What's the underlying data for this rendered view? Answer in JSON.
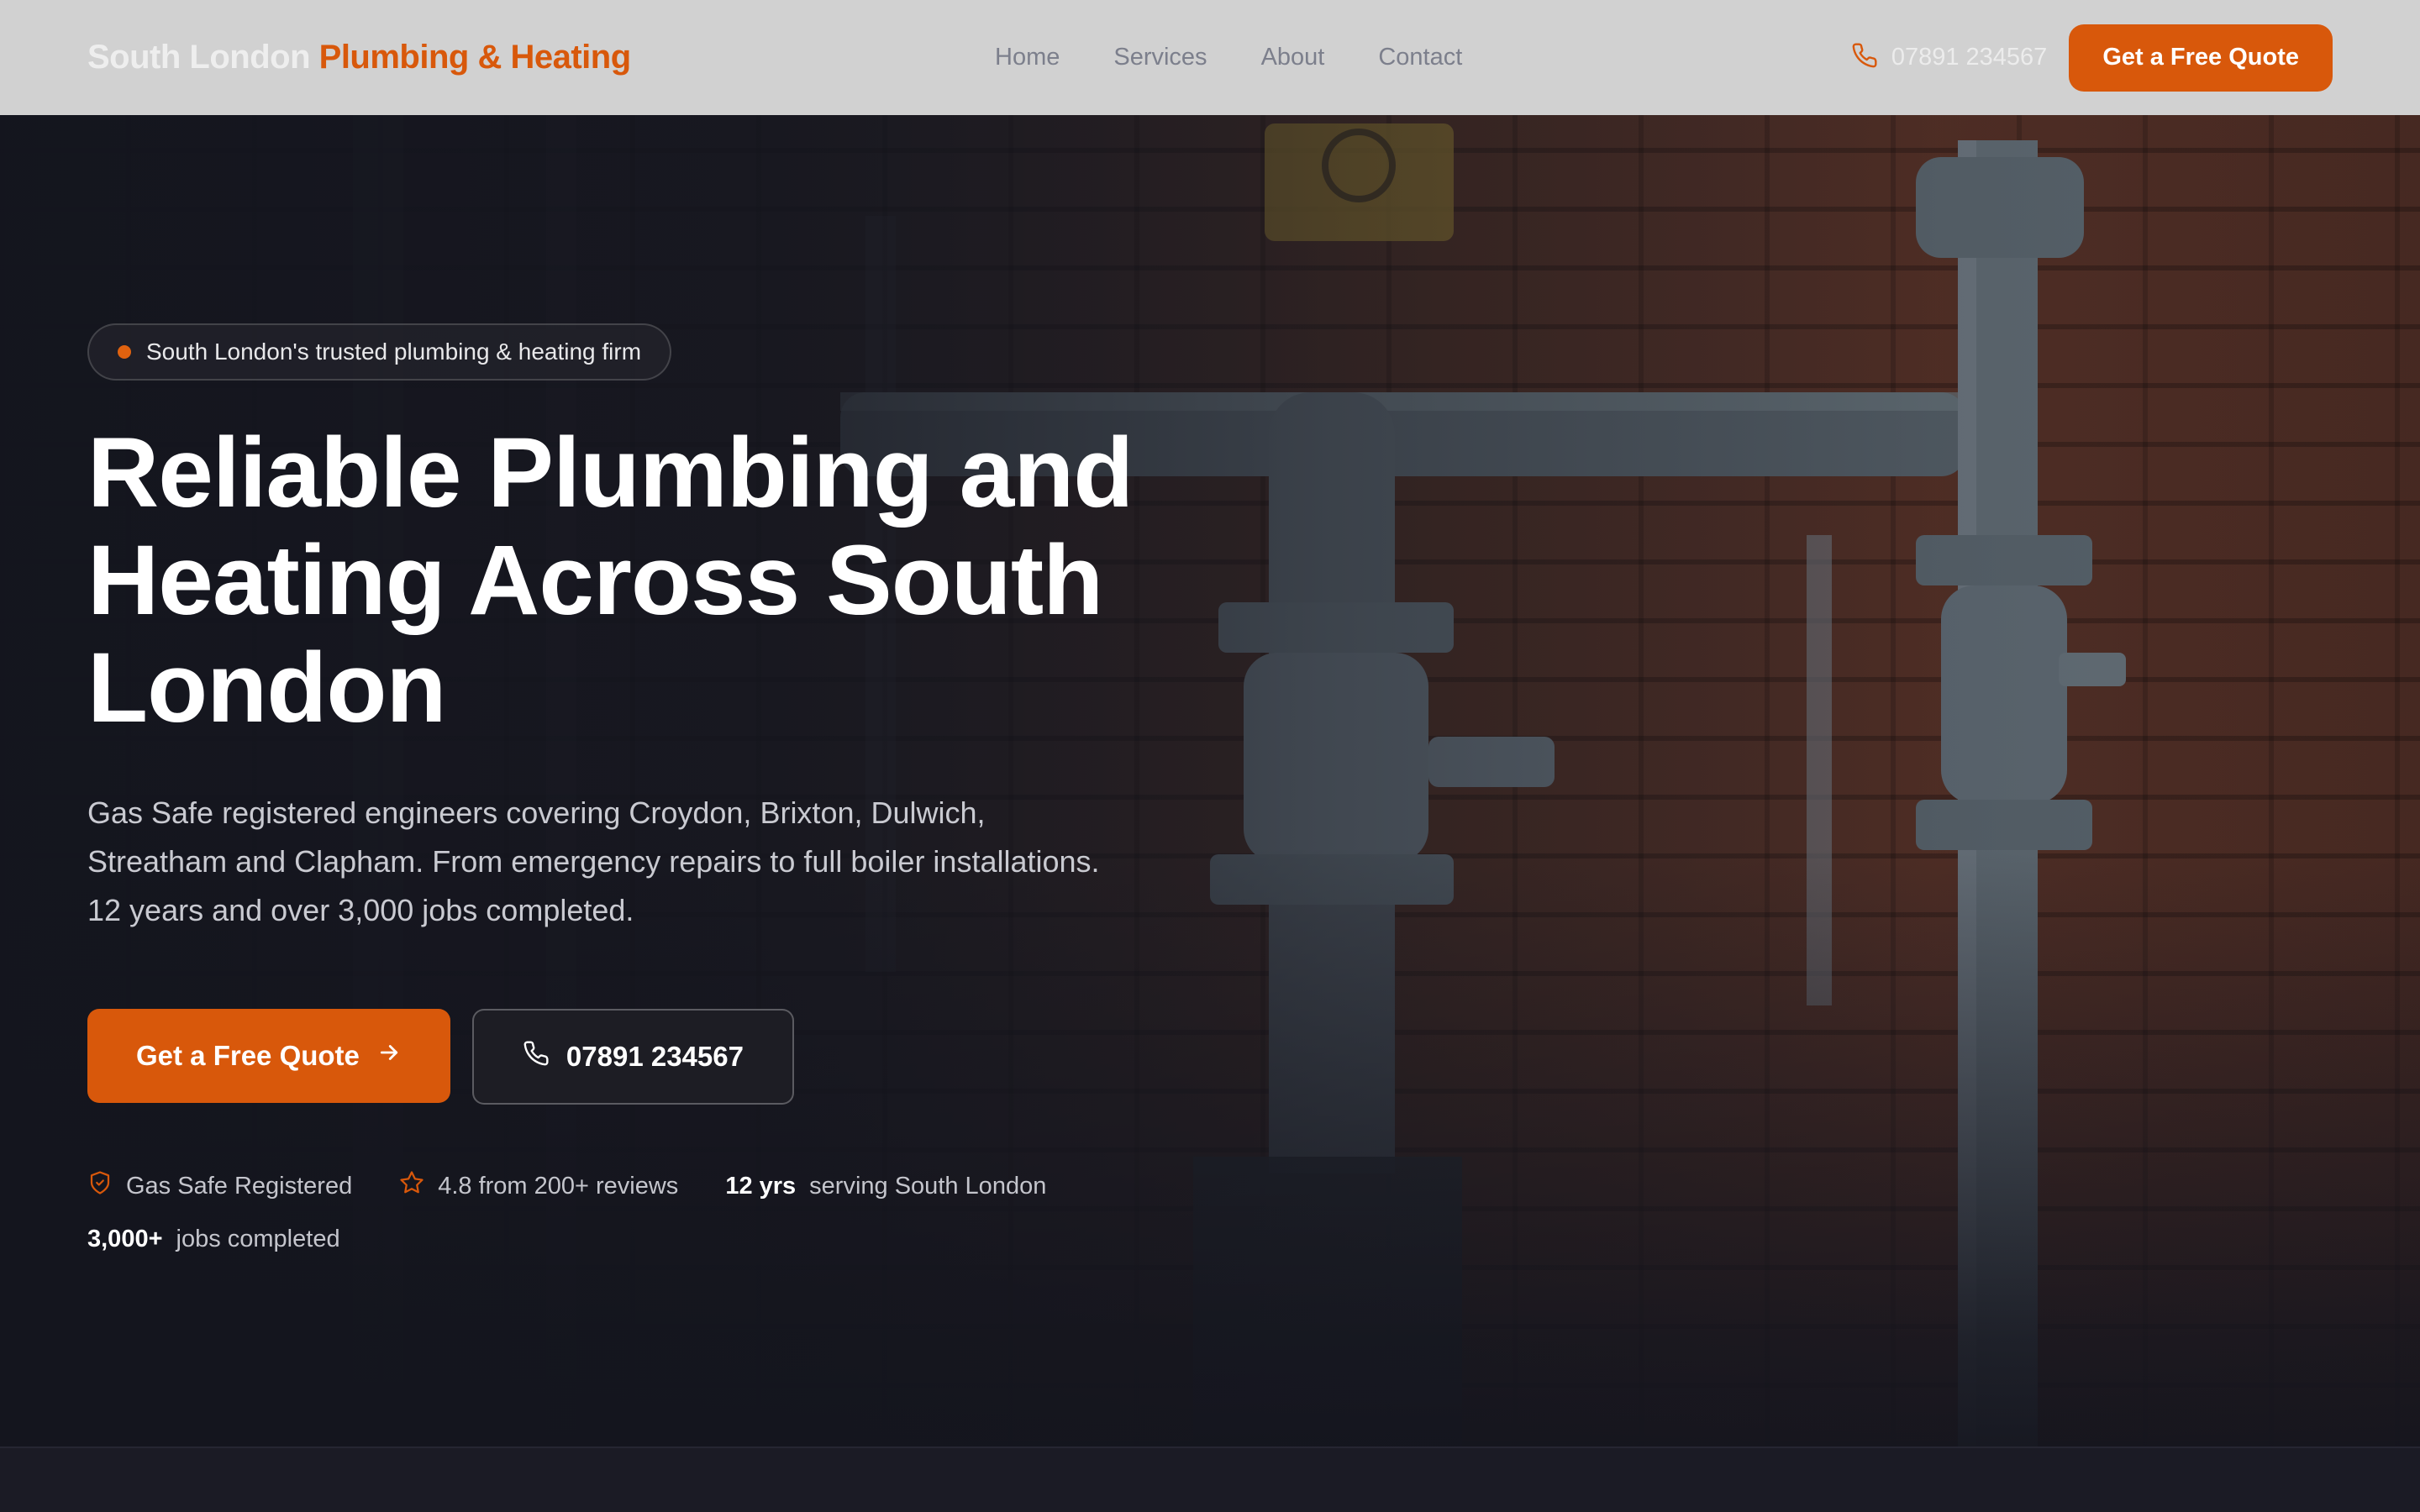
{
  "nav": {
    "brand_part1": "South London",
    "brand_part2": "Plumbing & Heating",
    "links": [
      "Home",
      "Services",
      "About",
      "Contact"
    ],
    "phone": "07891 234567",
    "cta": "Get a Free Quote"
  },
  "hero": {
    "tag": "South London's trusted plumbing & heating firm",
    "title": "Reliable Plumbing and Heating Across South London",
    "subtitle": "Gas Safe registered engineers covering Croydon, Brixton, Dulwich, Streatham and Clapham. From emergency repairs to full boiler installations. 12 years and over 3,000 jobs completed.",
    "cta_primary": "Get a Free Quote",
    "cta_secondary": "07891 234567",
    "trust": {
      "gas_safe": "Gas Safe Registered",
      "reviews": "4.8 from 200+ reviews",
      "years_value": "12 yrs",
      "years_label": "serving South London",
      "jobs_value": "3,000+",
      "jobs_label": "jobs completed"
    }
  },
  "colors": {
    "accent": "#d8580b",
    "nav_bg": "#d1d1d1",
    "hero_bg": "#14151e"
  },
  "icons": {
    "phone": "phone-icon",
    "arrow": "arrow-right-icon",
    "shield": "shield-check-icon",
    "star": "star-icon"
  }
}
